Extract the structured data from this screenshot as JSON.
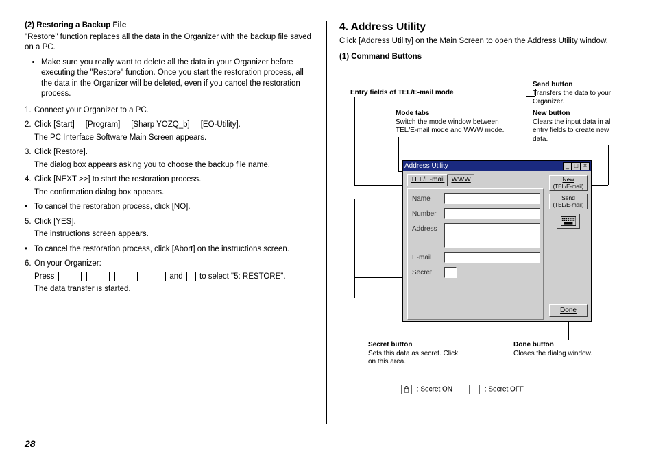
{
  "pageNumber": "28",
  "left": {
    "heading": "(2)  Restoring a Backup File",
    "intro": "\"Restore\" function replaces all the data in the Organizer with the backup file saved on a PC.",
    "bullet1": "Make sure you really want to delete all the data in your Organizer before executing the \"Restore\" function. Once you start the restoration process, all the data in the Organizer will be deleted, even if you cancel the restoration process.",
    "ol": {
      "i1_n": "1.",
      "i1": "Connect your Organizer to a PC.",
      "i2_n": "2.",
      "i2_prefix": "Click [Start]",
      "i2_mid1": "[Program]",
      "i2_mid2": "[Sharp YOZQ_b]",
      "i2_end": "[EO-Utility].",
      "i2_sub": "The PC Interface Software Main Screen appears.",
      "i3_n": "3.",
      "i3": "Click [Restore].",
      "i3_sub": "The dialog box appears asking you to choose the backup file name.",
      "i4_n": "4.",
      "i4": "Click [NEXT >>] to start the restoration process.",
      "i4_sub": "The confirmation dialog box appears.",
      "i4_bul": "To cancel the restoration process, click [NO].",
      "i5_n": "5.",
      "i5": "Click [YES].",
      "i5_sub": "The instructions screen appears.",
      "i5_bul": "To cancel the restoration process, click [Abort] on the instructions screen.",
      "i6_n": "6.",
      "i6": "On your Organizer:",
      "i6_line_a": "Press ",
      "i6_line_b": " and ",
      "i6_line_c": " to select \"5: RESTORE\".",
      "i6_sub": "The data transfer is started."
    }
  },
  "right": {
    "heading": "4. Address Utility",
    "intro": "Click [Address Utility] on the Main Screen to open the Address Utility window.",
    "sub": "(1)  Command Buttons",
    "callouts": {
      "entry": "Entry fields of TEL/E-mail mode",
      "mode_b": "Mode tabs",
      "mode_t": "Switch the mode window between TEL/E-mail mode and WWW mode.",
      "send_b": "Send button",
      "send_t": "Transfers the data to your Organizer.",
      "new_b": "New button",
      "new_t": "Clears the input data in all entry fields to create new data.",
      "secret_b": "Secret button",
      "secret_t": "Sets this data as secret. Click on this area.",
      "done_b": "Done button",
      "done_t": "Closes the dialog window.",
      "legend_on": ": Secret ON",
      "legend_off": ": Secret OFF"
    },
    "app": {
      "title": "Address Utility",
      "tab1": "TEL/E-mail",
      "tab2": "WWW",
      "lbl_name": "Name",
      "lbl_number": "Number",
      "lbl_address": "Address",
      "lbl_email": "E-mail",
      "lbl_secret": "Secret",
      "btn_new_a": "New",
      "btn_new_b": "(TEL/E-mail)",
      "btn_send_a": "Send",
      "btn_send_b": "(TEL/E-mail)",
      "btn_done": "Done"
    }
  }
}
